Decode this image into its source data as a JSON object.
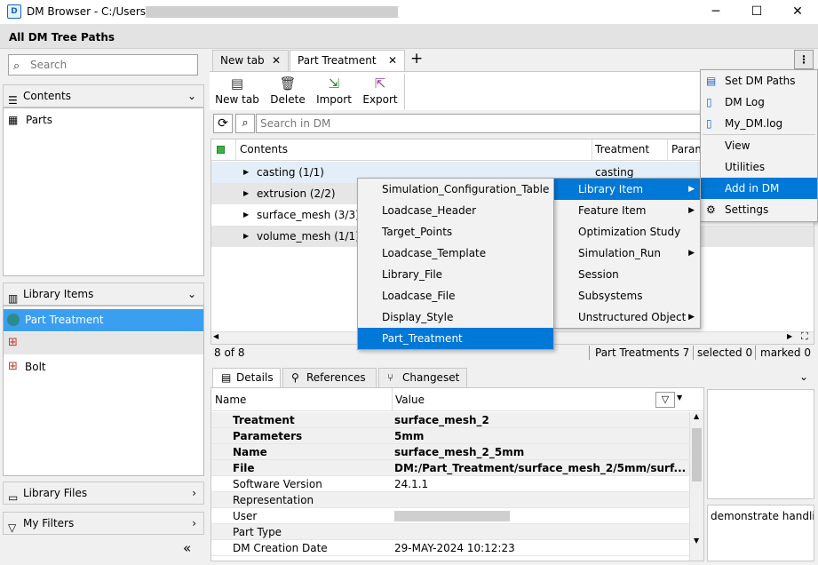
{
  "window": {
    "title": "DM Browser - C:/Users/",
    "minimize_glyph": "─",
    "maximize_glyph": "☐",
    "close_glyph": "✕"
  },
  "section_title": "All DM Tree Paths",
  "left": {
    "search_placeholder": "Search",
    "contents_label": "Contents",
    "contents_items": [
      "Parts"
    ],
    "library_items_label": "Library Items",
    "library_items": [
      "Part Treatment",
      "",
      "Bolt"
    ],
    "library_files_label": "Library Files",
    "my_filters_label": "My Filters",
    "collapse_glyph": "«"
  },
  "tabs": [
    {
      "label": "New tab"
    },
    {
      "label": "Part Treatment"
    }
  ],
  "toolbar": {
    "new_tab": "New tab",
    "delete": "Delete",
    "import": "Import",
    "export": "Export"
  },
  "search_dm_placeholder": "Search in DM",
  "grid": {
    "columns": [
      "Contents",
      "Treatment",
      "Param"
    ],
    "rows": [
      {
        "name": "casting (1/1)",
        "treatment": "casting"
      },
      {
        "name": "extrusion (2/2)",
        "treatment": ""
      },
      {
        "name": "surface_mesh (3/3)",
        "treatment": ""
      },
      {
        "name": "volume_mesh (1/1)",
        "treatment": ""
      }
    ],
    "footer_left": "8 of 8",
    "footer_count": "Part Treatments 7",
    "footer_selected": "selected 0",
    "footer_marked": "marked 0"
  },
  "context_menu_main": [
    {
      "label": "Set DM Paths",
      "icon": "paths-icon"
    },
    {
      "label": "DM Log",
      "icon": "log-icon"
    },
    {
      "label": "My_DM.log",
      "icon": "log-icon"
    },
    {
      "label": "View"
    },
    {
      "label": "Utilities"
    },
    {
      "label": "Add in DM",
      "selected": true
    },
    {
      "label": "Settings",
      "icon": "settings-icon"
    }
  ],
  "submenu_add": [
    {
      "label": "Library Item",
      "arrow": true,
      "selected": true
    },
    {
      "label": "Feature Item",
      "arrow": true
    },
    {
      "label": "Optimization Study"
    },
    {
      "label": "Simulation_Run",
      "arrow": true
    },
    {
      "label": "Session"
    },
    {
      "label": "Subsystems"
    },
    {
      "label": "Unstructured Object",
      "arrow": true
    }
  ],
  "submenu_library": [
    {
      "label": "Simulation_Configuration_Table"
    },
    {
      "label": "Loadcase_Header"
    },
    {
      "label": "Target_Points"
    },
    {
      "label": "Loadcase_Template"
    },
    {
      "label": "Library_File"
    },
    {
      "label": "Loadcase_File"
    },
    {
      "label": "Display_Style"
    },
    {
      "label": "Part_Treatment",
      "selected": true
    }
  ],
  "details": {
    "tabs": [
      "Details",
      "References",
      "Changeset"
    ],
    "columns": [
      "Name",
      "Value"
    ],
    "rows": [
      {
        "name": "Treatment",
        "value": "surface_mesh_2",
        "bold": true
      },
      {
        "name": "Parameters",
        "value": "5mm",
        "bold": true
      },
      {
        "name": "Name",
        "value": "surface_mesh_2_5mm",
        "bold": true
      },
      {
        "name": "File",
        "value": "DM:/Part_Treatment/surface_mesh_2/5mm/surf...",
        "bold": true
      },
      {
        "name": "Software Version",
        "value": "24.1.1"
      },
      {
        "name": "Representation",
        "value": ""
      },
      {
        "name": "User",
        "value": ""
      },
      {
        "name": "Part Type",
        "value": ""
      },
      {
        "name": "DM Creation Date",
        "value": "29-MAY-2024 10:12:23"
      }
    ],
    "side_text": "demonstrate handlin"
  },
  "colors": {
    "accent": "#0078d7",
    "selected_item_bg": "#3a9ff0",
    "menu_bg": "#f2f2f2"
  }
}
